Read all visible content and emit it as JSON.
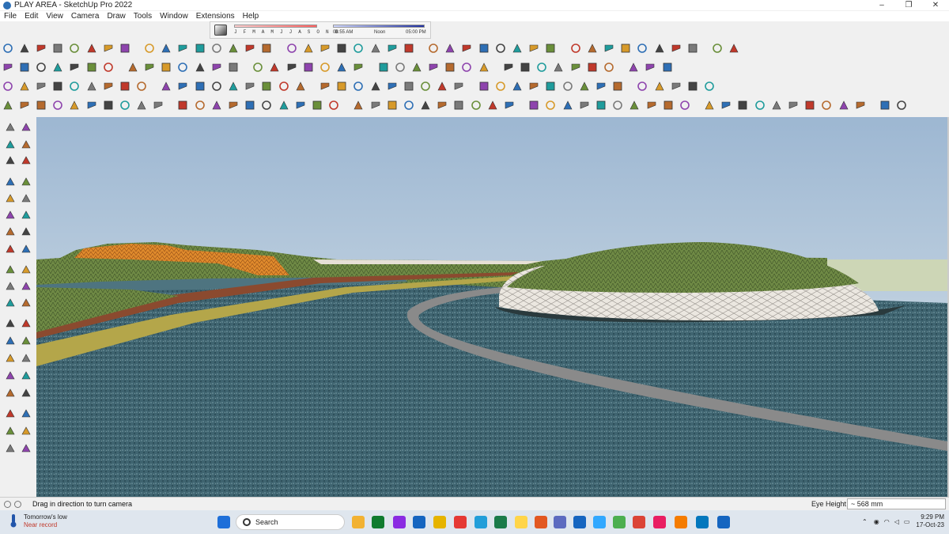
{
  "window": {
    "title": "PLAY AREA - SketchUp Pro 2022",
    "controls": [
      "–",
      "❐",
      "✕"
    ]
  },
  "menu": [
    "File",
    "Edit",
    "View",
    "Camera",
    "Draw",
    "Tools",
    "Window",
    "Extensions",
    "Help"
  ],
  "shadows": {
    "months": "J F M A M J J A S O N D",
    "time_start": "06:55 AM",
    "time_mid": "Noon",
    "time_end": "05:00 PM"
  },
  "status": {
    "message": "Drag in direction to turn camera",
    "vcb_label": "Eye Height",
    "vcb_value": "~ 568 mm"
  },
  "taskbar": {
    "weather_line1": "Tomorrow's low",
    "weather_line2": "Near record",
    "search_placeholder": "Search",
    "time": "9:29 PM",
    "date": "17-Oct-23"
  },
  "colors": {
    "sky_top": "#9db7d2",
    "sky_bottom": "#d6e2ea",
    "water": "#3f6470",
    "grass": "#7e9a4c",
    "orange_hill": "#d8822a",
    "stone": "#eae6df",
    "path_brown": "#8b4a2f",
    "path_yellow": "#b4a64a"
  }
}
